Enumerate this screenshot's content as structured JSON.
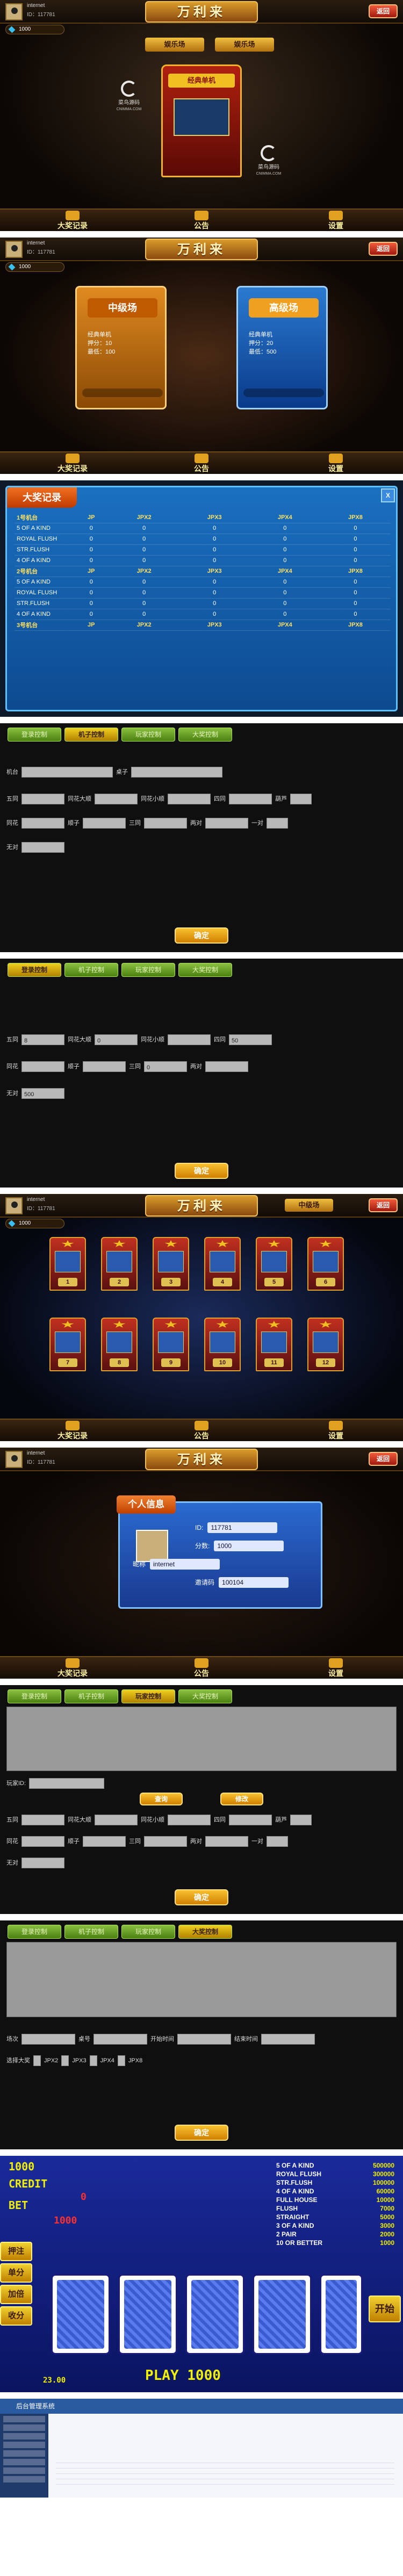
{
  "common": {
    "title": "万利来",
    "back_label": "返回",
    "username": "internet",
    "user_id": "ID：117781",
    "coins": "1000",
    "bottom_left": "大奖记录",
    "bottom_mid": "公告",
    "bottom_right": "设置",
    "watermark_line1": "菜鸟源码",
    "watermark_line2": "CNIMMA.COM"
  },
  "p1": {
    "tab_left": "娱乐场",
    "tab_right": "娱乐场",
    "machine_label": "经典单机"
  },
  "p2": {
    "room1_title": "中级场",
    "room1_sub": "经典单机",
    "room1_line1": "押分：10",
    "room1_line2": "最低：100",
    "room2_title": "高级场",
    "room2_sub": "经典单机",
    "room2_line1": "押分：20",
    "room2_line2": "最低：500"
  },
  "p3": {
    "title": "大奖记录",
    "close": "X",
    "headers": [
      "JP",
      "JPX2",
      "JPX3",
      "JPX4",
      "JPX8"
    ],
    "section1": "1号机台",
    "section2": "2号机台",
    "section3": "3号机台",
    "rows": [
      "5 OF A KIND",
      "ROYAL FLUSH",
      "STR.FLUSH",
      "4 OF A KIND"
    ],
    "zero": "0"
  },
  "ctl1": {
    "tabs": [
      "登录控制",
      "机子控制",
      "玩家控制",
      "大奖控制"
    ],
    "active_tab": 1,
    "labels": [
      "机台",
      "桌子",
      "五同",
      "同花大顺",
      "同花小顺",
      "四同",
      "葫芦",
      "同花",
      "顺子",
      "三同",
      "两对",
      "一对",
      "无对"
    ],
    "ok": "确定"
  },
  "ctl2": {
    "tabs": [
      "登录控制",
      "机子控制",
      "玩家控制",
      "大奖控制"
    ],
    "active_tab": 0,
    "values": [
      "8",
      "0",
      "50",
      "0",
      "500"
    ],
    "ok": "确定"
  },
  "p6": {
    "room_tag": "中级场",
    "numbers": [
      "1",
      "2",
      "3",
      "4",
      "5",
      "6",
      "7",
      "8",
      "9",
      "10",
      "11",
      "12"
    ]
  },
  "p7": {
    "title": "个人信息",
    "id_label": "ID:",
    "id_value": "117781",
    "name_label": "昵称",
    "name_value": "internet",
    "coin_label": "分数:",
    "coin_value": "1000",
    "invite_label": "邀请码",
    "invite_value": "100104"
  },
  "ctl3": {
    "tabs": [
      "登录控制",
      "机子控制",
      "玩家控制",
      "大奖控制"
    ],
    "active_tab": 2,
    "player_id": "玩家ID:",
    "btn1": "查询",
    "btn2": "修改",
    "ok": "确定"
  },
  "ctl4": {
    "tabs": [
      "登录控制",
      "机子控制",
      "玩家控制",
      "大奖控制"
    ],
    "active_tab": 3,
    "labels": [
      "场次",
      "桌号",
      "开始时间",
      "结束时间"
    ],
    "options": [
      "选择大奖",
      "JPX2",
      "JPX3",
      "JPX4",
      "JPX8"
    ],
    "ok": "确定"
  },
  "poker": {
    "credit_num": "1000",
    "credit_label": "CREDIT",
    "credit_val": "0",
    "bet_label": "BET",
    "bet_val": "1000",
    "play": "PLAY 1000",
    "side": [
      "押注",
      "单分",
      "加倍",
      "收分"
    ],
    "start": "开始",
    "table": [
      [
        "5 OF A KIND",
        "500000"
      ],
      [
        "ROYAL FLUSH",
        "300000"
      ],
      [
        "STR.FLUSH",
        "100000"
      ],
      [
        "4 OF A KIND",
        "60000"
      ],
      [
        "FULL HOUSE",
        "10000"
      ],
      [
        "FLUSH",
        "7000"
      ],
      [
        "STRAIGHT",
        "5000"
      ],
      [
        "3 OF A KIND",
        "3000"
      ],
      [
        "2 PAIR",
        "2000"
      ],
      [
        "10 OR BETTER",
        "1000"
      ]
    ],
    "footer": "23.00"
  },
  "admin": {
    "title": "后台管理系统"
  }
}
